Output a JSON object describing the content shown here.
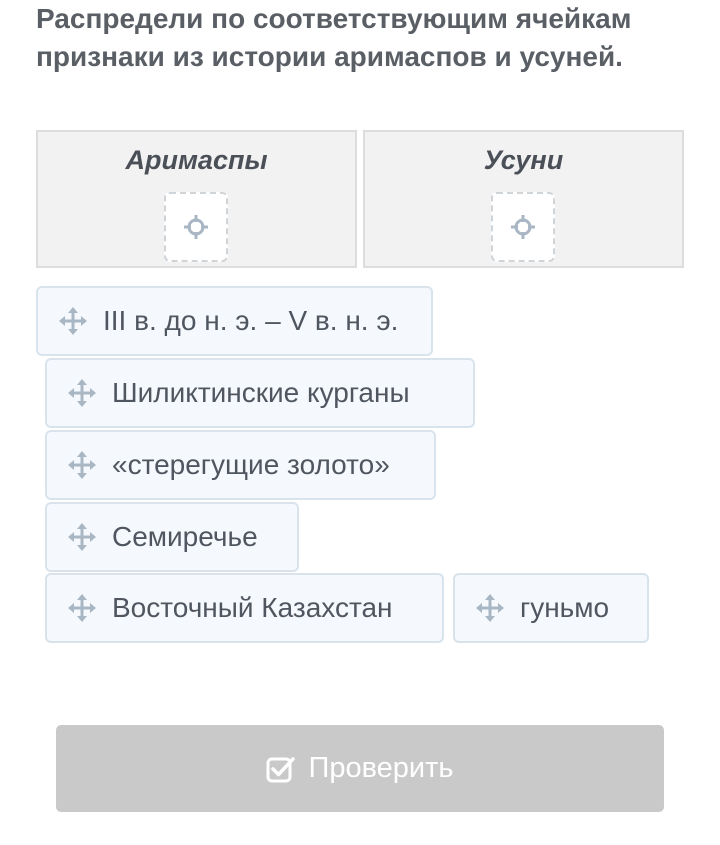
{
  "question": {
    "text": "Распредели по соответствующим ячейкам признаки из истории аримаспов и усуней."
  },
  "cells": [
    {
      "title": "Аримаспы"
    },
    {
      "title": "Усуни"
    }
  ],
  "chips": [
    {
      "label": "III в. до н. э. – V в. н. э."
    },
    {
      "label": "Шиликтинские курганы"
    },
    {
      "label": "«стерегущие золото»"
    },
    {
      "label": "Семиречье"
    },
    {
      "label": "Восточный Казахстан"
    },
    {
      "label": "гуньмо"
    }
  ],
  "check_button": {
    "label": "Проверить",
    "icon": "checkbox-checked-icon"
  },
  "colors": {
    "chip_bg": "#f5f9fd",
    "chip_border": "#d9e3ec",
    "cell_bg": "#f2f2f2",
    "button_disabled": "#c9c9c9",
    "icon": "#a9b6c3"
  }
}
